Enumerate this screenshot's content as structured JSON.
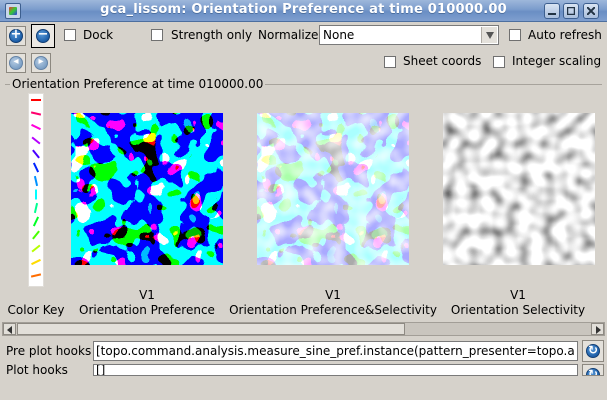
{
  "window": {
    "title": "gca_lissom: Orientation Preference at time 010000.00"
  },
  "toolbar": {
    "zoom_in_icon": "plus-circle-icon",
    "zoom_out_icon": "minus-circle-icon",
    "back_icon": "back-arrow-icon",
    "forward_icon": "forward-arrow-icon",
    "dock_label": "Dock",
    "strength_only_label": "Strength only",
    "normalize_label": "Normalize",
    "normalize_value": "None",
    "auto_refresh_label": "Auto refresh",
    "sheet_coords_label": "Sheet coords",
    "integer_scaling_label": "Integer scaling"
  },
  "group": {
    "label": "Orientation Preference at time 010000.00"
  },
  "plots": [
    {
      "sheet": "V1",
      "name": "Orientation Preference"
    },
    {
      "sheet": "V1",
      "name": "Orientation Preference&Selectivity"
    },
    {
      "sheet": "V1",
      "name": "Orientation Selectivity"
    }
  ],
  "color_key": {
    "label": "Color Key"
  },
  "hooks": {
    "pre_plot_label": "Pre plot hooks",
    "pre_plot_value": "[topo.command.analysis.measure_sine_pref.instance(pattern_presenter=topo.a",
    "plot_label": "Plot hooks",
    "plot_value": "[]"
  },
  "colors": {
    "titlebar": "#7b9ccc",
    "background": "#d6d2cb"
  }
}
